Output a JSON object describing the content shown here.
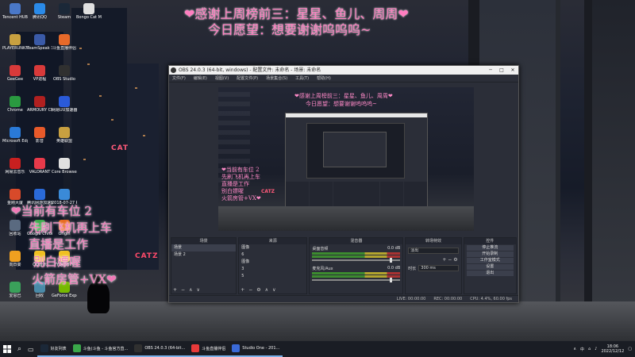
{
  "overlay": {
    "top_line_1": "❤感谢上周榜前三：星星、鱼儿、周周❤",
    "top_line_2": "今日愿望：想要谢谢呜呜呜~",
    "left_lines": [
      "❤当前有车位 2",
      "先刷飞机再上车",
      "直播是工作",
      "别白嫖喔",
      "火箭房管+VX❤"
    ]
  },
  "desktop": {
    "icons": [
      {
        "label": "Tencent HUB",
        "color": "#4a78c8"
      },
      {
        "label": "PLAYERUNKNOWN BATTLEGRO...",
        "color": "#c8a040"
      },
      {
        "label": "GeeGee",
        "color": "#d83a3a"
      },
      {
        "label": "Chrome",
        "color": "#2a9a40"
      },
      {
        "label": "Microsoft Edge",
        "color": "#2a7ad8"
      },
      {
        "label": "网易云音乐",
        "color": "#c82020"
      },
      {
        "label": "金刚大厦",
        "color": "#d84a2a"
      },
      {
        "label": "回收站",
        "color": "#5a6a80"
      },
      {
        "label": "向日葵",
        "color": "#f0a020"
      },
      {
        "label": "爱思巴",
        "color": "#3aa05a"
      },
      {
        "label": "腾讯QQ",
        "color": "#2a8ae8"
      },
      {
        "label": "TeamSpeak 3 Client",
        "color": "#3a5aa8"
      },
      {
        "label": "VP进程",
        "color": "#d83a3a"
      },
      {
        "label": "ARMOURY CRATE",
        "color": "#b02020"
      },
      {
        "label": "影音",
        "color": "#e85a2a"
      },
      {
        "label": "VALORANT",
        "color": "#e83a4a"
      },
      {
        "label": "腾讯网游加速器",
        "color": "#2a6ad8"
      },
      {
        "label": "Google Chrome",
        "color": "#3aa84a"
      },
      {
        "label": "QQ音乐",
        "color": "#f0c020"
      },
      {
        "label": "回收",
        "color": "#4a8aa8"
      },
      {
        "label": "Steam",
        "color": "#1b2838"
      },
      {
        "label": "斗鱼直播伴侣",
        "color": "#e86a2a"
      },
      {
        "label": "OBS Studio",
        "color": "#303030"
      },
      {
        "label": "网易UU加速器",
        "color": "#2a5ad8"
      },
      {
        "label": "英雄联盟",
        "color": "#c8a040"
      },
      {
        "label": "Core Browser",
        "color": "#e0e0e0"
      },
      {
        "label": "2018-07-27 PreSonus...",
        "color": "#3a8ad8"
      },
      {
        "label": "Origin",
        "color": "#e86a20"
      },
      {
        "label": "YY语音6TV",
        "color": "#f0c020"
      },
      {
        "label": "GeForce Experience",
        "color": "#76b900"
      },
      {
        "label": "Bongo Cat Mver",
        "color": "#e0e0e0"
      }
    ]
  },
  "obs": {
    "title": "OBS 24.0.3 (64-bit, windows) - 配置文件: 未命名 - 场景: 未命名",
    "menu": [
      "文件(F)",
      "编辑(E)",
      "视图(V)",
      "配置文件(P)",
      "场景集合(S)",
      "工具(T)",
      "帮助(H)"
    ],
    "panels": {
      "scenes_header": "场景",
      "scenes": [
        "场景",
        "场景 2"
      ],
      "sources_header": "来源",
      "sources": [
        "图像",
        "6",
        "图像",
        "3",
        "5"
      ],
      "mixer_header": "混音器",
      "mixer": [
        {
          "name": "桌面音频",
          "db": "0.0 dB"
        },
        {
          "name": "麦克风/Aux",
          "db": "0.0 dB"
        }
      ],
      "transitions_header": "转场特效",
      "transition": "淡出",
      "duration_label": "时长",
      "duration": "300 ms",
      "controls_header": "控件",
      "controls": [
        "停止推流",
        "开始录制",
        "工作室模式",
        "设置",
        "退出"
      ]
    },
    "status": {
      "live": "LIVE: 00:00:00",
      "rec": "REC: 00:00:00",
      "cpu": "CPU: 4.4%, 60.00 fps"
    }
  },
  "taskbar": {
    "items": [
      {
        "label": "好友列表",
        "color": "#1b2838"
      },
      {
        "label": "斗鱼(斗鱼 - 斗鱼官方直...",
        "color": "#3aa84a"
      },
      {
        "label": "OBS 24.0.3 (64-bit...",
        "color": "#303030"
      },
      {
        "label": "斗鱼直播伴侣",
        "color": "#e83a3a"
      },
      {
        "label": "Studio One - 201...",
        "color": "#3a6ad8"
      }
    ],
    "ime": "中",
    "time": "18:06",
    "date": "2022/12/12"
  }
}
